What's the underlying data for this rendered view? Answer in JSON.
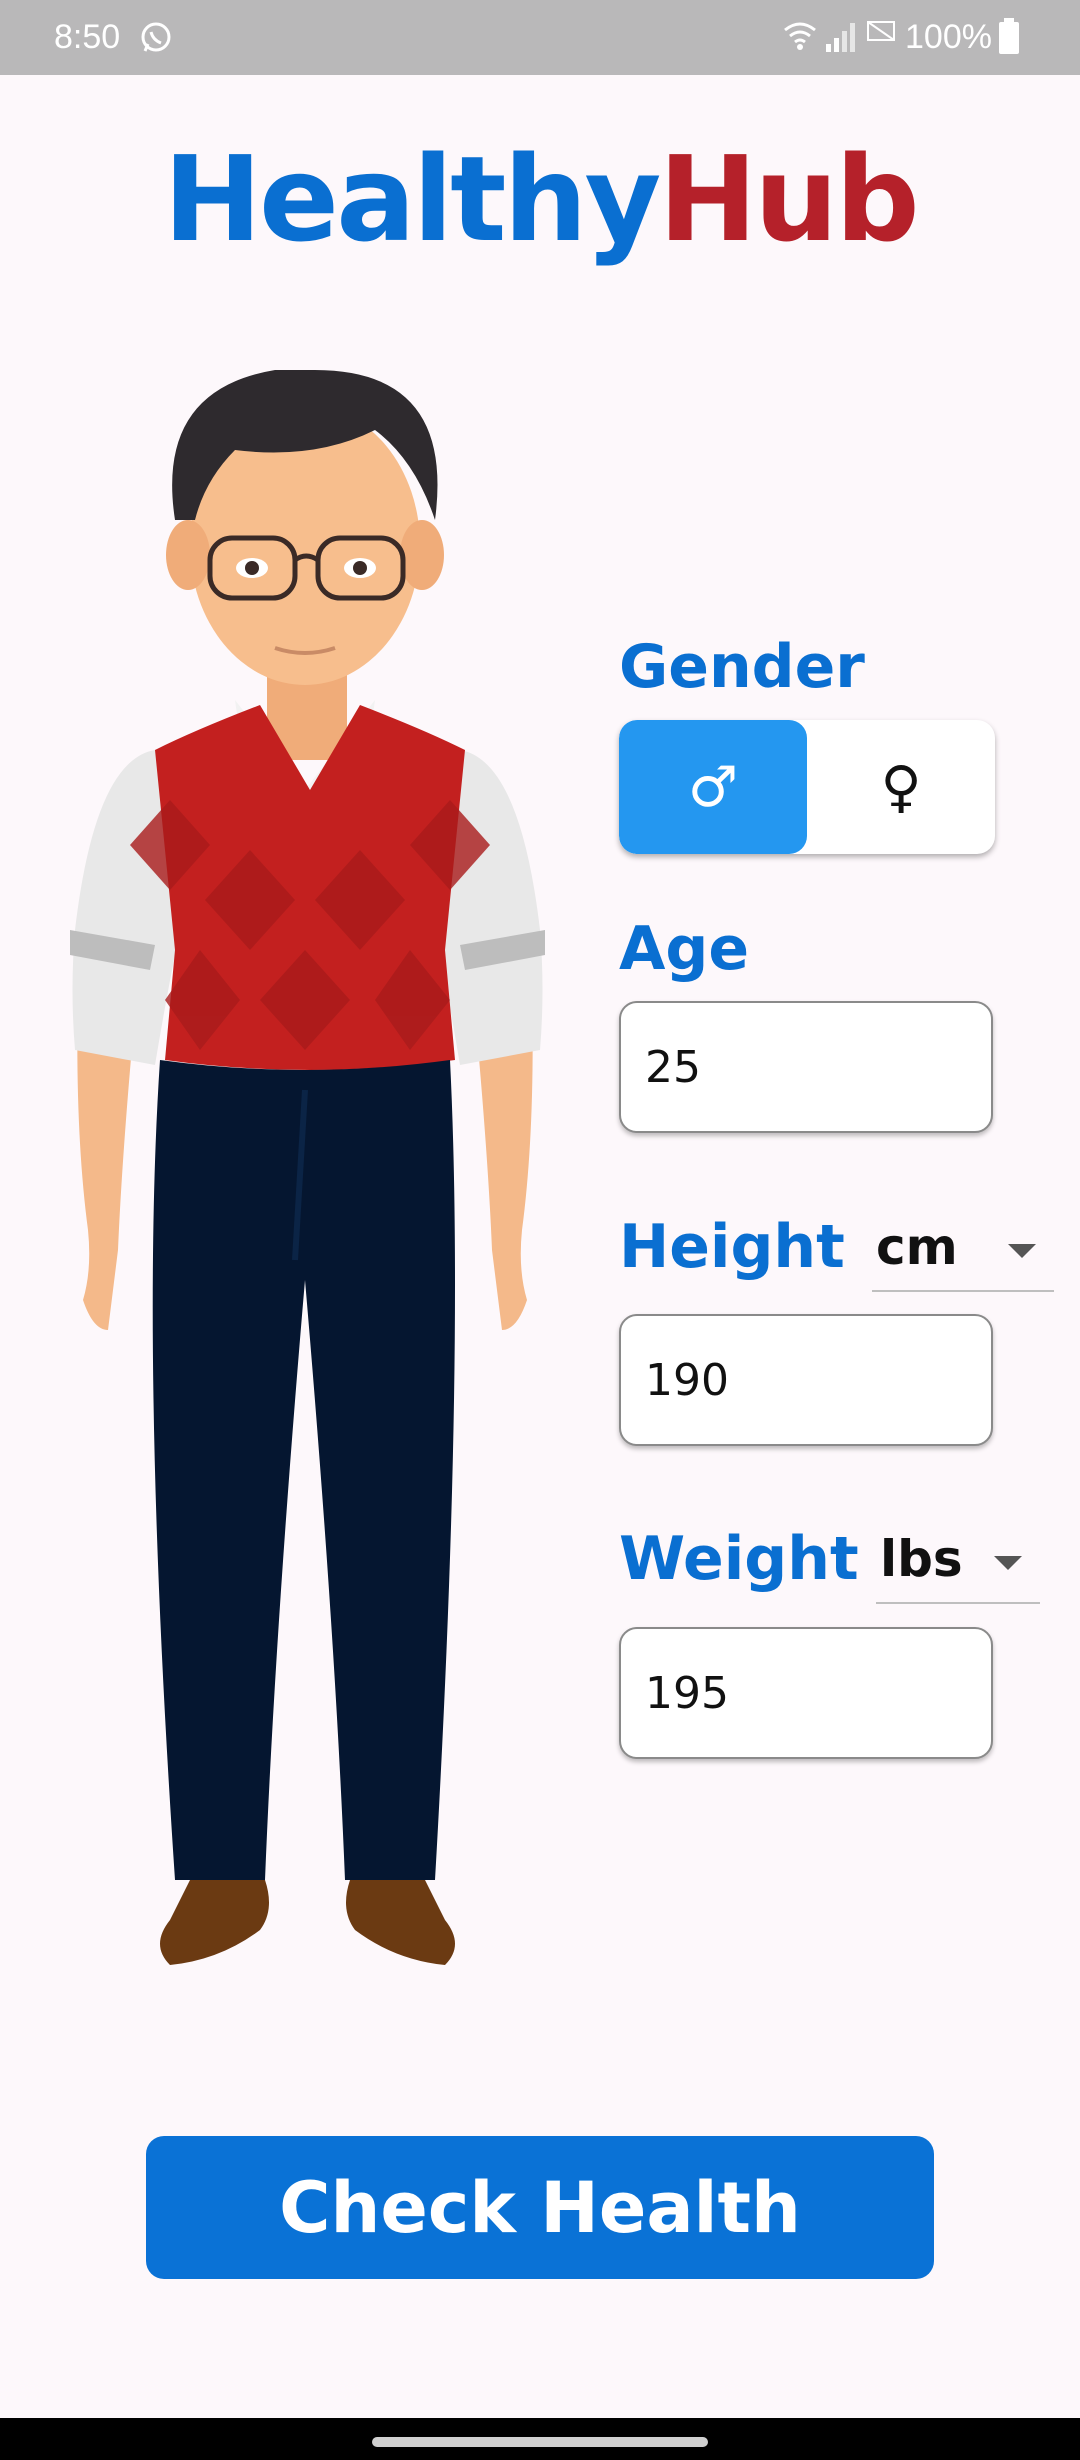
{
  "status_bar": {
    "time": "8:50",
    "battery": "100%",
    "icons": [
      "whatsapp-icon",
      "wifi-icon",
      "signal-icon",
      "no-sim-icon",
      "battery-icon"
    ]
  },
  "app": {
    "logo_part1": "Healthy",
    "logo_part2": "Hub",
    "colors": {
      "primary": "#0A6FD1",
      "accent": "#B5212A",
      "toggle_active": "#2497F0"
    }
  },
  "form": {
    "gender_label": "Gender",
    "gender_options": [
      "♂",
      "♀"
    ],
    "gender_selected": "male",
    "age_label": "Age",
    "age_value": "25",
    "height_label": "Height",
    "height_unit": "cm",
    "height_value": "190",
    "weight_label": "Weight",
    "weight_unit": "lbs",
    "weight_value": "195"
  },
  "actions": {
    "check_label": "Check Health"
  }
}
